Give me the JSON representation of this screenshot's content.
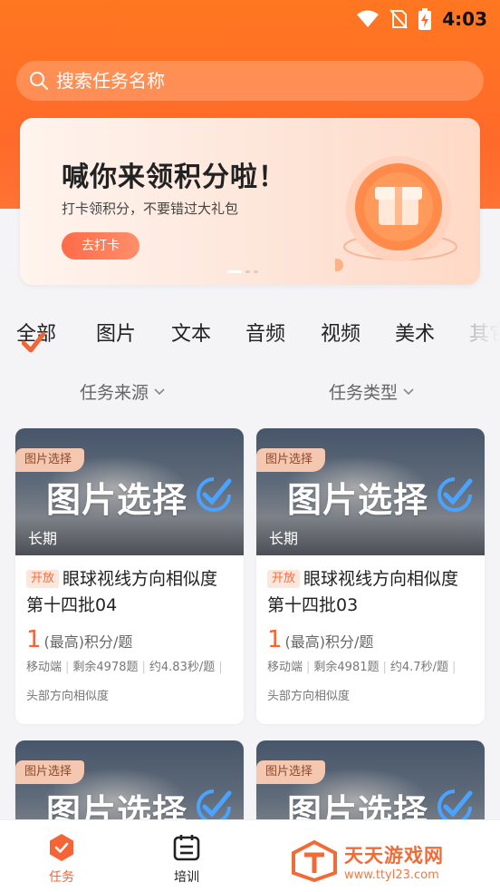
{
  "status_bar": {
    "time": "4:03"
  },
  "search": {
    "placeholder": "搜索任务名称"
  },
  "banner": {
    "title": "喊你来领积分啦！",
    "subtitle": "打卡领积分，不要错过大礼包",
    "button": "去打卡"
  },
  "categories": [
    "全部",
    "图片",
    "文本",
    "音频",
    "视频",
    "美术",
    "其它"
  ],
  "selected_category": "全部",
  "filters": {
    "source": "任务来源",
    "type": "任务类型"
  },
  "cards": [
    {
      "tag": "图片选择",
      "thumb_title": "图片选择",
      "duration": "长期",
      "status": "开放",
      "name": "眼球视线方向相似度第十四批04",
      "points": "1",
      "points_unit": "(最高)积分/题",
      "platform": "移动端",
      "remaining": "剩余4978题",
      "time_per": "约4.83秒/题",
      "category": "头部方向相似度"
    },
    {
      "tag": "图片选择",
      "thumb_title": "图片选择",
      "duration": "长期",
      "status": "开放",
      "name": "眼球视线方向相似度第十四批03",
      "points": "1",
      "points_unit": "(最高)积分/题",
      "platform": "移动端",
      "remaining": "剩余4981题",
      "time_per": "约4.7秒/题",
      "category": "头部方向相似度"
    },
    {
      "tag": "图片选择",
      "thumb_title": "图片选择"
    },
    {
      "tag": "图片选择",
      "thumb_title": "图片选择"
    }
  ],
  "tabbar": {
    "tasks": "任务",
    "training": "培训"
  },
  "watermark": {
    "title": "天天游戏网",
    "url": "www.ttyl23.com"
  },
  "colors": {
    "accent": "#f56434",
    "header": "#ff7a1e",
    "tag_bg": "#f4c7b0"
  },
  "icons": {
    "search": "search-icon",
    "wifi": "wifi-icon",
    "signal": "no-signal-icon",
    "battery": "battery-charging-icon",
    "check": "check-icon",
    "chevron": "chevron-down-icon"
  }
}
